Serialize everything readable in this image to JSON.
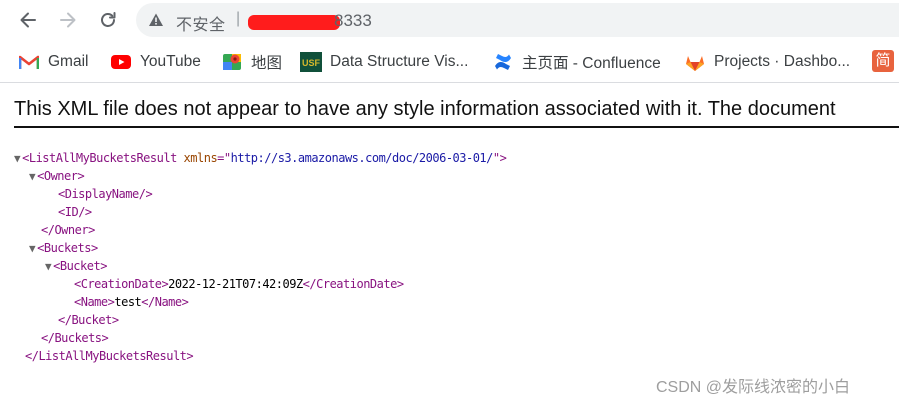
{
  "browser": {
    "security_label": "不安全",
    "separator": "|",
    "url_visible": "8333"
  },
  "bookmarks": [
    {
      "label": "Gmail",
      "icon": "gmail-icon"
    },
    {
      "label": "YouTube",
      "icon": "youtube-icon"
    },
    {
      "label": "地图",
      "icon": "maps-icon"
    },
    {
      "label": "Data Structure Vis...",
      "icon": "usf-icon",
      "icon_text": "USF"
    },
    {
      "label": "主页面 - Confluence",
      "icon": "confluence-icon"
    },
    {
      "label": "Projects · Dashbo...",
      "icon": "gitlab-icon"
    },
    {
      "label": "简",
      "icon": "jian-icon"
    }
  ],
  "viewer": {
    "banner": "This XML file does not appear to have any style information associated with it. The document"
  },
  "xml": {
    "root_tag": "ListAllMyBucketsResult",
    "root_attr_name": "xmlns",
    "root_attr_value": "http://s3.amazonaws.com/doc/2006-03-01/",
    "owner_tag": "Owner",
    "display_name_tag": "DisplayName",
    "id_tag": "ID",
    "buckets_tag": "Buckets",
    "bucket_tag": "Bucket",
    "creation_date_tag": "CreationDate",
    "creation_date_value": "2022-12-21T07:42:09Z",
    "name_tag": "Name",
    "name_value": "test"
  },
  "watermark": "CSDN @发际线浓密的小白",
  "colors": {
    "tag": "#881280",
    "attribute": "#994500",
    "attribute_value": "#1a1aa6",
    "redaction": "#ff1c1c"
  }
}
